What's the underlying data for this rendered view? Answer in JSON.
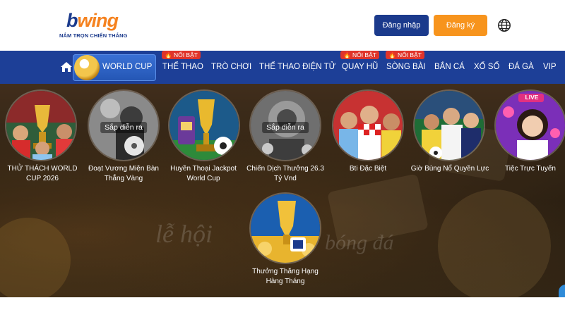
{
  "header": {
    "logo_text": "bwing",
    "logo_tagline": "NẮM TRỌN CHIẾN THẮNG",
    "login_label": "Đăng nhập",
    "register_label": "Đăng ký",
    "language_icon": "globe-icon"
  },
  "nav": {
    "home_icon": "home-icon",
    "world_cup_label": "WORLD CUP",
    "hot_badge": "NỔI BẬT",
    "items": [
      {
        "label": "THỂ THAO"
      },
      {
        "label": "TRÒ CHƠI"
      },
      {
        "label": "THỂ THAO ĐIỆN TỬ"
      },
      {
        "label": "QUAY HŨ"
      },
      {
        "label": "SÒNG BÀI"
      },
      {
        "label": "BẮN CÁ"
      },
      {
        "label": "XỔ SỐ"
      },
      {
        "label": "ĐÁ GÀ"
      },
      {
        "label": "VIP"
      }
    ]
  },
  "banner": {
    "background_text_1": "lễ hội",
    "background_text_2": "bóng đá"
  },
  "promotions": [
    {
      "title": "THỬ THÁCH WORLD CUP 2026",
      "status": ""
    },
    {
      "title": "Đoạt Vương Miện Bàn Thắng Vàng",
      "status": "Sắp diễn ra"
    },
    {
      "title": "Huyền Thoại Jackpot World Cup",
      "status": ""
    },
    {
      "title": "Chiến Dịch Thưởng 26.3 Tỷ Vnd",
      "status": "Sắp diễn ra"
    },
    {
      "title": "Bti Đặc Biệt",
      "status": ""
    },
    {
      "title": "Giờ Bùng Nổ Quyền Lực",
      "status": ""
    },
    {
      "title": "Tiệc Trực Tuyến",
      "status": "",
      "live_badge": "LIVE"
    },
    {
      "title": "Thưởng Thăng Hạng Hàng Tháng",
      "status": ""
    }
  ],
  "colors": {
    "brand_blue": "#1b3a8c",
    "brand_orange": "#f7941d",
    "nav_blue": "#1d3f97",
    "hot_red": "#e0342a"
  }
}
